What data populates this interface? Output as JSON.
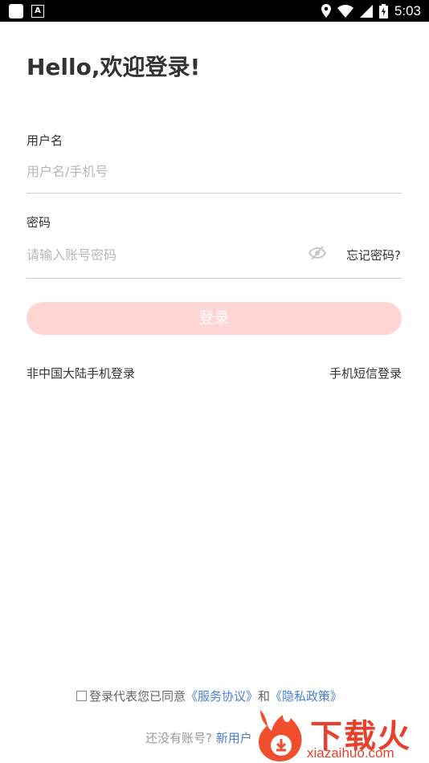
{
  "status_bar": {
    "time": "5:03"
  },
  "title": "Hello,欢迎登录!",
  "username": {
    "label": "用户名",
    "placeholder": "用户名/手机号"
  },
  "password": {
    "label": "密码",
    "placeholder": "请输入账号密码",
    "forgot": "忘记密码?"
  },
  "login_button": "登录",
  "links": {
    "non_mainland": "非中国大陆手机登录",
    "sms_login": "手机短信登录"
  },
  "agreement": {
    "prefix": "登录代表您已同意",
    "service": "《服务协议》",
    "and": "和",
    "privacy": "《隐私政策》"
  },
  "register": {
    "prompt": "还没有账号?",
    "link": "新用户"
  },
  "watermark": {
    "text": "下载火",
    "url": "xiazaihuo.com"
  },
  "colors": {
    "accent": "#ff6a5c",
    "button_disabled": "#ffd6d4",
    "link": "#4a7fd6"
  }
}
